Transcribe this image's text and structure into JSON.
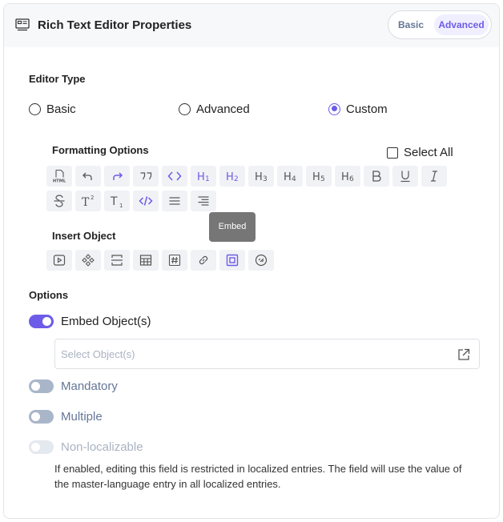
{
  "header": {
    "icon": "properties-icon",
    "title": "Rich Text Editor Properties",
    "mode_tabs": [
      {
        "label": "Basic",
        "selected": false
      },
      {
        "label": "Advanced",
        "selected": true
      }
    ]
  },
  "editor_type": {
    "label": "Editor Type",
    "options": [
      {
        "label": "Basic",
        "selected": false
      },
      {
        "label": "Advanced",
        "selected": false
      },
      {
        "label": "Custom",
        "selected": true
      }
    ]
  },
  "formatting": {
    "label": "Formatting Options",
    "select_all": {
      "label": "Select All",
      "checked": false
    },
    "tools": [
      {
        "name": "html",
        "icon": "html-icon",
        "active": false
      },
      {
        "name": "undo",
        "icon": "undo-icon",
        "active": false
      },
      {
        "name": "redo",
        "icon": "redo-icon",
        "active": true
      },
      {
        "name": "blockquote",
        "icon": "blockquote-icon",
        "active": false
      },
      {
        "name": "code",
        "icon": "code-icon",
        "active": true
      },
      {
        "name": "h1",
        "icon": "heading-1-icon",
        "active": true
      },
      {
        "name": "h2",
        "icon": "heading-2-icon",
        "active": true
      },
      {
        "name": "h3",
        "icon": "heading-3-icon",
        "active": false
      },
      {
        "name": "h4",
        "icon": "heading-4-icon",
        "active": false
      },
      {
        "name": "h5",
        "icon": "heading-5-icon",
        "active": false
      },
      {
        "name": "h6",
        "icon": "heading-6-icon",
        "active": false
      },
      {
        "name": "bold",
        "icon": "bold-icon",
        "active": false
      },
      {
        "name": "underline",
        "icon": "underline-icon",
        "active": false
      },
      {
        "name": "italic",
        "icon": "italic-icon",
        "active": false
      },
      {
        "name": "strikethrough",
        "icon": "strikethrough-icon",
        "active": false
      },
      {
        "name": "superscript",
        "icon": "superscript-icon",
        "active": false
      },
      {
        "name": "subscript",
        "icon": "subscript-icon",
        "active": false
      },
      {
        "name": "code-block",
        "icon": "code-block-icon",
        "active": true
      },
      {
        "name": "align-justify",
        "icon": "align-justify-icon",
        "active": false
      },
      {
        "name": "align-right",
        "icon": "align-right-icon",
        "active": false
      }
    ]
  },
  "insert_object": {
    "label": "Insert Object",
    "tooltip": "Embed",
    "tools": [
      {
        "name": "video",
        "icon": "video-icon",
        "active": false
      },
      {
        "name": "widget",
        "icon": "widget-icon",
        "active": false
      },
      {
        "name": "divider",
        "icon": "divider-icon",
        "active": false
      },
      {
        "name": "table",
        "icon": "table-icon",
        "active": false
      },
      {
        "name": "hashtag",
        "icon": "hashtag-icon",
        "active": false
      },
      {
        "name": "link",
        "icon": "link-icon",
        "active": false
      },
      {
        "name": "embed",
        "icon": "embed-icon",
        "active": true
      },
      {
        "name": "reference",
        "icon": "reference-icon",
        "active": false
      }
    ]
  },
  "options": {
    "label": "Options",
    "embed": {
      "label": "Embed Object(s)",
      "on": true
    },
    "select_placeholder": "Select Object(s)",
    "mandatory": {
      "label": "Mandatory",
      "on": false
    },
    "multiple": {
      "label": "Multiple",
      "on": false
    },
    "non_localizable": {
      "label": "Non-localizable",
      "on": false,
      "disabled": true
    },
    "help_text": "If enabled, editing this field is restricted in localized entries. The field will use the value of the master-language entry in all localized entries."
  },
  "colors": {
    "accent": "#6c5ce7",
    "text": "#222222",
    "muted": "#647696",
    "disabled_text": "#a9b3c2",
    "toolbar_bg": "#f1f2f5",
    "tooltip_bg": "#767676",
    "toggle_off": "#a9b6c9"
  }
}
